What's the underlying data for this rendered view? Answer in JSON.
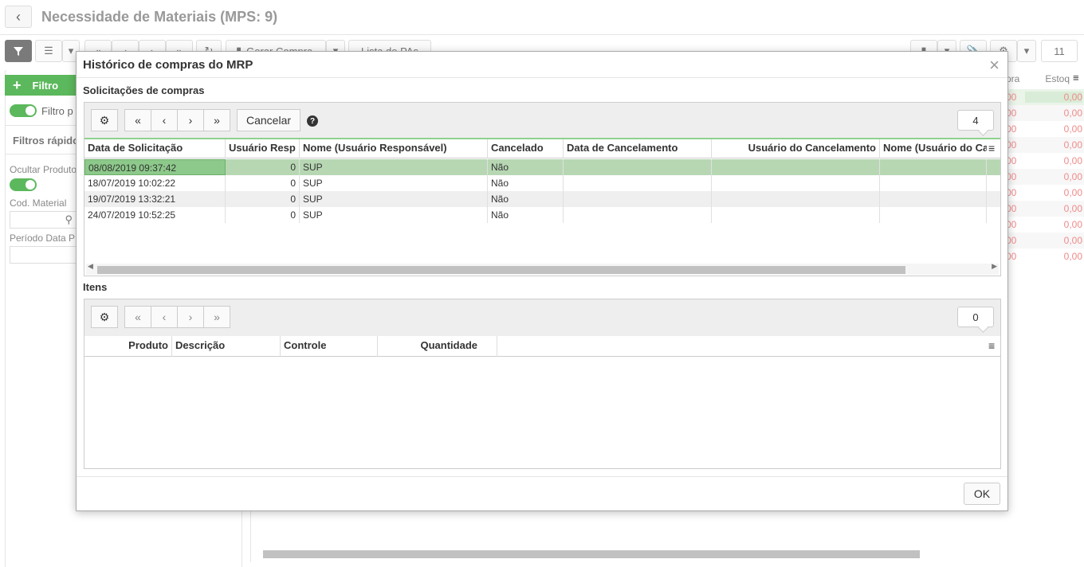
{
  "page": {
    "title": "Necessidade de Materiais (MPS: 9)",
    "toolbar": {
      "gerar_compra": "Gerar Compra",
      "lista_pas": "Lista de PAs",
      "count": "11"
    },
    "left": {
      "add_filter": "Filtro",
      "filter_toggle_label": "Filtro p",
      "quick_filters": "Filtros rápido",
      "hide_products": "Ocultar Produto",
      "cod_material": "Cod. Material",
      "periodo": "Período Data P"
    },
    "grid": {
      "col_compra": "pra",
      "col_estoque": "Estoq",
      "values": [
        "00",
        "00",
        "00",
        "00",
        "00",
        "00",
        "00",
        "00",
        "00",
        "00",
        "00"
      ],
      "values_right": [
        "0,00",
        "0,00",
        "0,00",
        "0,00",
        "0,00",
        "0,00",
        "0,00",
        "0,00",
        "0,00",
        "0,00",
        "0,00"
      ]
    }
  },
  "modal": {
    "title": "Histórico de compras do MRP",
    "close": "×",
    "requests": {
      "section_label": "Solicitações de compras",
      "cancel_button": "Cancelar",
      "count": "4",
      "columns": [
        "Data de Solicitação",
        "Usuário Resp",
        "Nome (Usuário Responsável)",
        "Cancelado",
        "Data de Cancelamento",
        "Usuário do Cancelamento",
        "Nome (Usuário do Ca"
      ],
      "rows": [
        {
          "data": "08/08/2019 09:37:42",
          "usuario": "0",
          "nome": "SUP",
          "cancelado": "Não"
        },
        {
          "data": "18/07/2019 10:02:22",
          "usuario": "0",
          "nome": "SUP",
          "cancelado": "Não"
        },
        {
          "data": "19/07/2019 13:32:21",
          "usuario": "0",
          "nome": "SUP",
          "cancelado": "Não"
        },
        {
          "data": "24/07/2019 10:52:25",
          "usuario": "0",
          "nome": "SUP",
          "cancelado": "Não"
        }
      ]
    },
    "items": {
      "section_label": "Itens",
      "count": "0",
      "columns": [
        "Produto",
        "Descrição",
        "Controle",
        "Quantidade"
      ]
    },
    "ok_button": "OK"
  },
  "colors": {
    "accent_green": "#5cb85c",
    "selected_row": "#b7d7b3",
    "value_red": "#f08a8a"
  }
}
